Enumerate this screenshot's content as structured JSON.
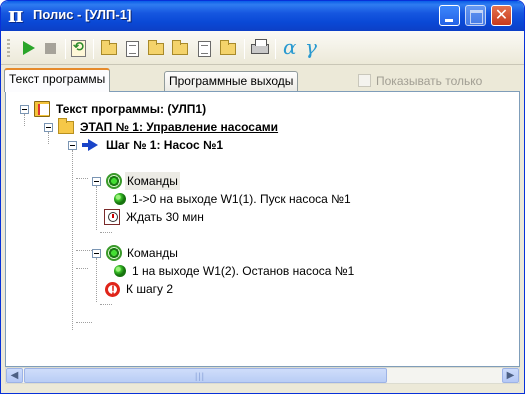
{
  "window": {
    "title": "Полис - [УЛП-1]",
    "app_icon_glyph": "π",
    "controls": {
      "minimize": "minimize-icon",
      "maximize": "maximize-icon",
      "close": "close-icon",
      "close_glyph": "✕"
    }
  },
  "toolbar": {
    "items": [
      "play-icon",
      "stop-icon",
      "refresh-icon",
      "open-folder-icon",
      "new-folder-icon",
      "folder-doc-icon",
      "folder-open-icon",
      "document-icon",
      "stack-icon",
      "printer-icon",
      "alpha-icon",
      "gamma-icon"
    ],
    "alpha": "α",
    "gamma": "γ"
  },
  "tabs": [
    {
      "label": "Текст программы",
      "active": true
    },
    {
      "label": "Программные выходы",
      "active": false
    }
  ],
  "filter_checkbox": {
    "label": "Показывать только",
    "checked": false,
    "enabled": false
  },
  "tree": {
    "root": "Текст программы:  (УЛП1)",
    "stage": "ЭТАП № 1: Управление насосами",
    "step": "Шаг № 1: Насос №1",
    "commands1": "Команды",
    "cmd1": "1->0 на выходе W1(1). Пуск насоса №1",
    "wait": "Ждать 30 мин",
    "commands2": "Команды",
    "cmd2": "1 на выходе W1(2). Останов насоса №1",
    "goto": "К шагу 2"
  },
  "colors": {
    "title_bar": "#0a49d6",
    "active_tab_accent": "#e68b2c",
    "window_bg": "#ece9d8"
  }
}
